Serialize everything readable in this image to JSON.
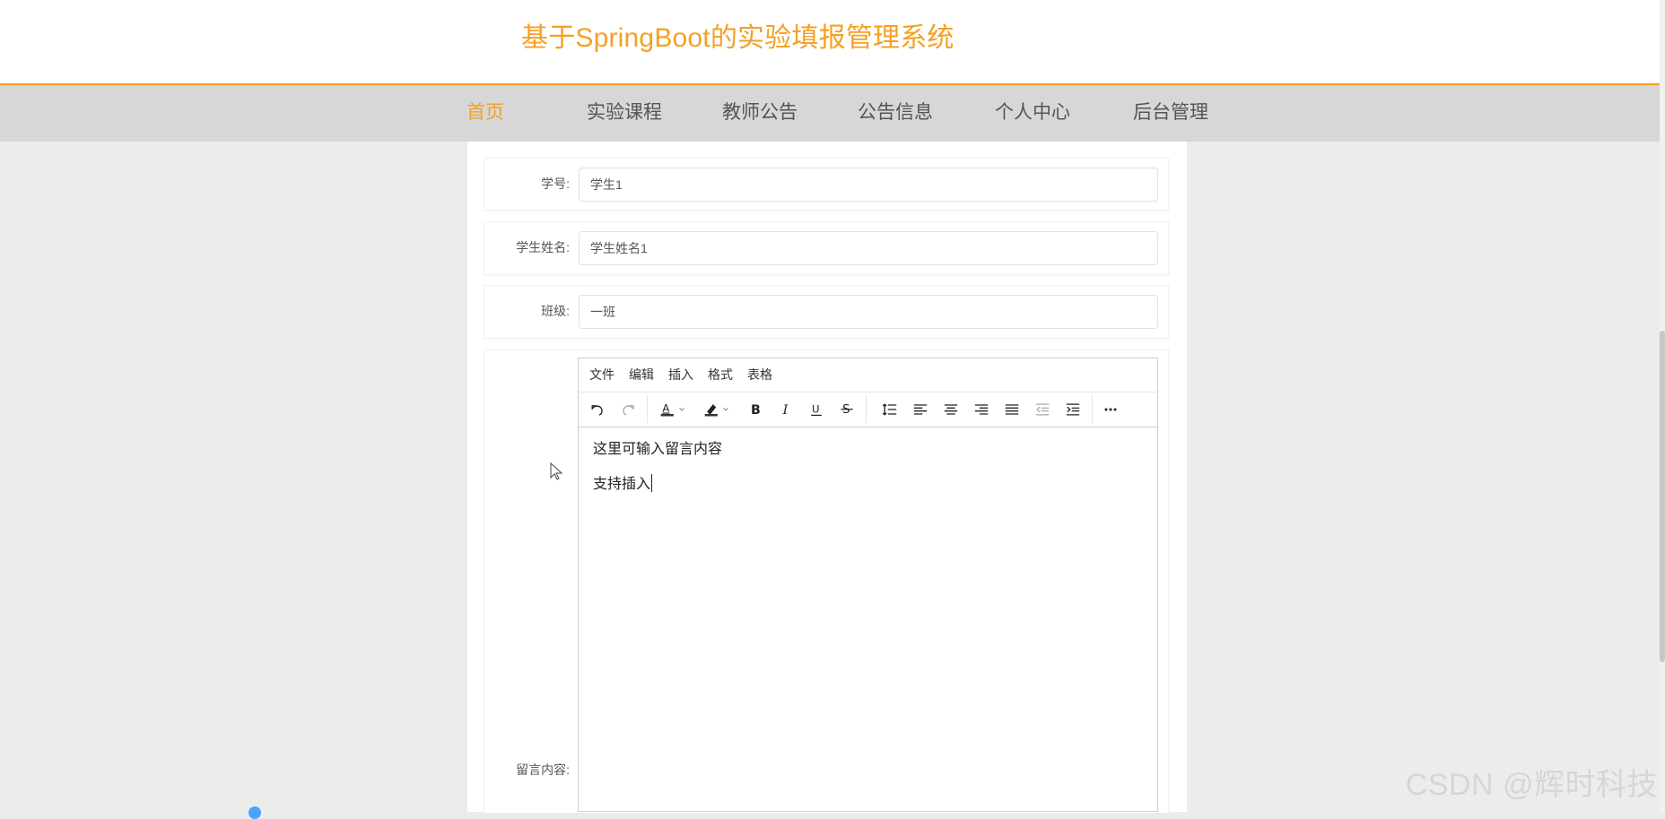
{
  "header": {
    "title": "基于SpringBoot的实验填报管理系统"
  },
  "nav": {
    "items": [
      {
        "label": "首页",
        "active": true
      },
      {
        "label": "实验课程",
        "active": false
      },
      {
        "label": "教师公告",
        "active": false
      },
      {
        "label": "公告信息",
        "active": false
      },
      {
        "label": "个人中心",
        "active": false
      },
      {
        "label": "后台管理",
        "active": false
      }
    ]
  },
  "form": {
    "student_id": {
      "label": "学号:",
      "value": "学生1"
    },
    "student_name": {
      "label": "学生姓名:",
      "value": "学生姓名1"
    },
    "class_name": {
      "label": "班级:",
      "value": "一班"
    },
    "message": {
      "label": "留言内容:",
      "menu": [
        "文件",
        "编辑",
        "插入",
        "格式",
        "表格"
      ],
      "content": [
        "这里可输入留言内容",
        "支持插入"
      ]
    }
  },
  "toolbar": {
    "icons": [
      "undo-icon",
      "redo-icon",
      "text-color-icon",
      "highlight-color-icon",
      "bold-icon",
      "italic-icon",
      "underline-icon",
      "strikethrough-icon",
      "line-height-icon",
      "align-left-icon",
      "align-center-icon",
      "align-right-icon",
      "align-justify-icon",
      "outdent-icon",
      "indent-icon",
      "more-icon"
    ],
    "text_color": "#333333",
    "highlight_color": "#333333"
  },
  "watermark": "CSDN @辉时科技",
  "colors": {
    "accent": "#f5a023",
    "nav_bg": "#d7d7d7",
    "page_bg": "#ececec"
  }
}
